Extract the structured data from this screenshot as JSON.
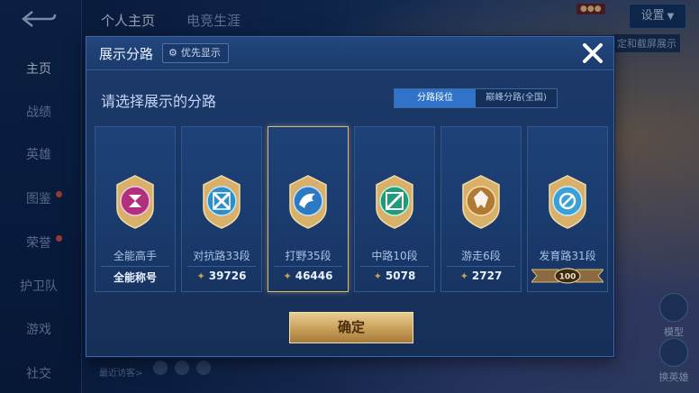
{
  "left_nav": {
    "items": [
      {
        "label": "主页",
        "active": true
      },
      {
        "label": "战绩",
        "active": false
      },
      {
        "label": "英雄",
        "active": false
      },
      {
        "label": "图鉴",
        "active": false
      },
      {
        "label": "荣誉",
        "active": false
      },
      {
        "label": "护卫队",
        "active": false
      },
      {
        "label": "游戏",
        "active": false
      },
      {
        "label": "社交",
        "active": false
      }
    ]
  },
  "top_tabs": [
    "个人主页",
    "电竞生涯"
  ],
  "top_right": {
    "settings_label": "设置",
    "side_hint": "定和截屏展示"
  },
  "right_buttons": [
    "模型",
    "换英雄"
  ],
  "bottom_hint": "最近访客>",
  "modal": {
    "title": "展示分路",
    "priority_label": "优先显示",
    "subtitle": "请选择展示的分路",
    "toggle": [
      "分路段位",
      "巅峰分路(全国)"
    ],
    "confirm_label": "确定"
  },
  "cards": [
    {
      "name": "全能高手",
      "footer": "全能称号",
      "icon": "all-round-badge-icon",
      "color": "#b0307e",
      "selected": false
    },
    {
      "name": "对抗路33段",
      "footer": "39726",
      "icon": "clash-lane-badge-icon",
      "color": "#2e8fc8",
      "selected": false
    },
    {
      "name": "打野35段",
      "footer": "46446",
      "icon": "jungle-badge-icon",
      "color": "#2c7ac4",
      "selected": true
    },
    {
      "name": "中路10段",
      "footer": "5078",
      "icon": "mid-lane-badge-icon",
      "color": "#1f9a7a",
      "selected": false
    },
    {
      "name": "游走6段",
      "footer": "2727",
      "icon": "roam-badge-icon",
      "color": "#b07a32",
      "selected": false
    },
    {
      "name": "发育路31段",
      "footer": "100",
      "icon": "farm-lane-badge-icon",
      "color": "#3aa0d8",
      "selected": false
    }
  ]
}
